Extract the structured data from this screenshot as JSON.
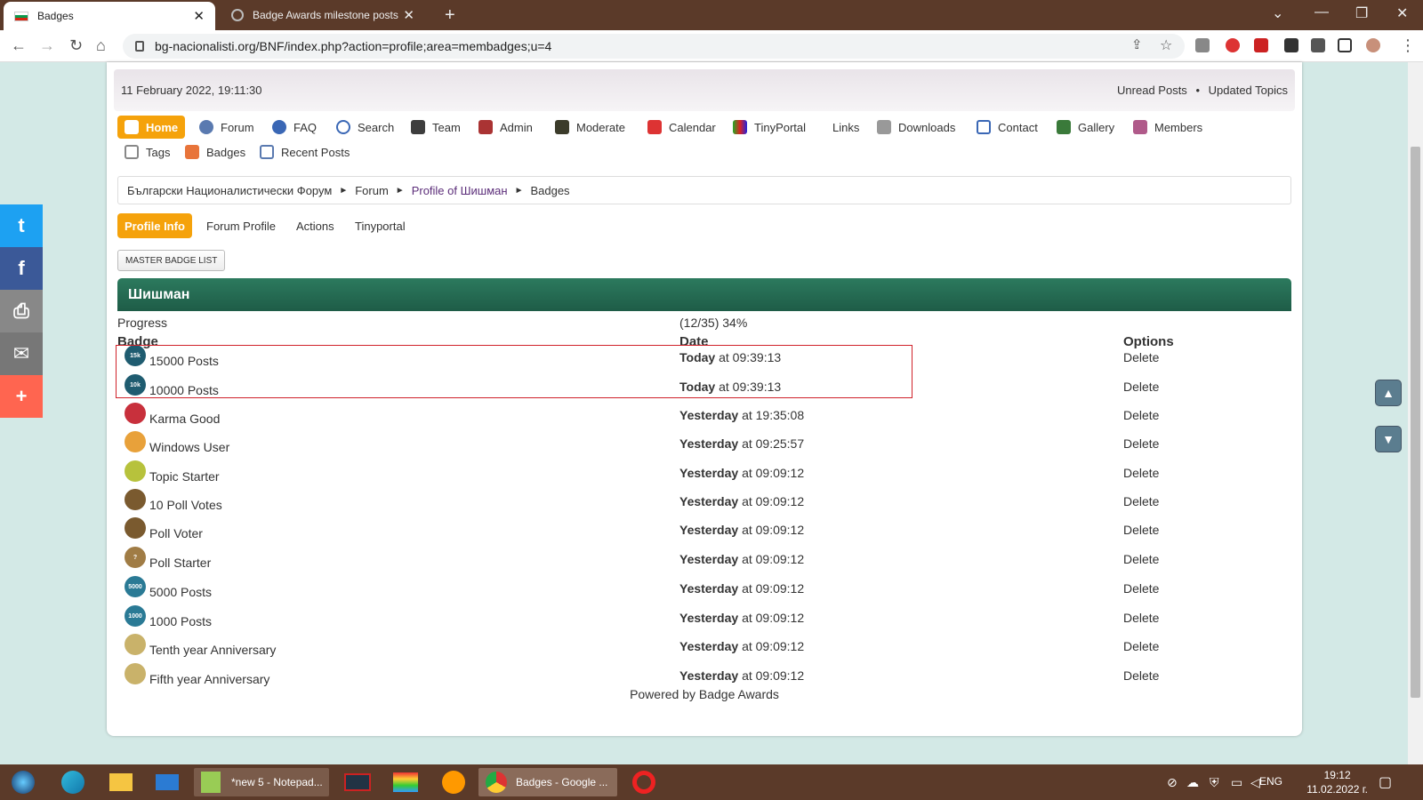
{
  "browser": {
    "tabs": [
      {
        "title": "Badges",
        "active": true
      },
      {
        "title": "Badge Awards milestone posts",
        "active": false
      }
    ],
    "url": "bg-nacionalisti.org/BNF/index.php?action=profile;area=membadges;u=4"
  },
  "header": {
    "date": "11 February 2022, 19:11:30",
    "unread_posts": "Unread Posts",
    "updated_topics": "Updated Topics",
    "dot": "•"
  },
  "menu": {
    "items": [
      {
        "label": "Home",
        "icon": "home-icon"
      },
      {
        "label": "Forum",
        "icon": "forum-icon"
      },
      {
        "label": "FAQ",
        "icon": "help-icon"
      },
      {
        "label": "Search",
        "icon": "search-icon"
      },
      {
        "label": "Team",
        "icon": "team-icon"
      },
      {
        "label": "Admin",
        "icon": "admin-icon"
      },
      {
        "label": "Moderate",
        "icon": "moderate-icon"
      },
      {
        "label": "Calendar",
        "icon": "calendar-icon"
      },
      {
        "label": "TinyPortal",
        "icon": "tinyportal-icon"
      },
      {
        "label": "Links",
        "icon": ""
      },
      {
        "label": "Downloads",
        "icon": "downloads-icon"
      },
      {
        "label": "Contact",
        "icon": "contact-icon"
      },
      {
        "label": "Gallery",
        "icon": "gallery-icon"
      },
      {
        "label": "Members",
        "icon": "members-icon"
      },
      {
        "label": "Tags",
        "icon": "tags-icon"
      },
      {
        "label": "Badges",
        "icon": "badges-icon"
      },
      {
        "label": "Recent Posts",
        "icon": "recent-posts-icon"
      }
    ]
  },
  "breadcrumb": {
    "items": [
      "Български Националистически Форум",
      "Forum",
      "Profile of Шишман",
      "Badges"
    ],
    "separator": "►"
  },
  "profile_tabs": [
    "Profile Info",
    "Forum Profile",
    "Actions",
    "Tinyportal"
  ],
  "master_badge_list": "MASTER BADGE LIST",
  "member_name": "Шишман",
  "progress": {
    "label": "Progress",
    "value": "(12/35) 34%"
  },
  "columns": {
    "badge": "Badge",
    "date": "Date",
    "options": "Options"
  },
  "badges": [
    {
      "name": "15000 Posts",
      "day": "Today",
      "time": "at 09:39:13",
      "action": "Delete",
      "icon_text": "15k",
      "color": "#1f5c70"
    },
    {
      "name": "10000 Posts",
      "day": "Today",
      "time": "at 09:39:13",
      "action": "Delete",
      "icon_text": "10k",
      "color": "#1f5c70"
    },
    {
      "name": "Karma Good",
      "day": "Yesterday",
      "time": "at 19:35:08",
      "action": "Delete",
      "icon_text": "",
      "color": "#c8303c"
    },
    {
      "name": "Windows User",
      "day": "Yesterday",
      "time": "at 09:25:57",
      "action": "Delete",
      "icon_text": "",
      "color": "#e8a13a"
    },
    {
      "name": "Topic Starter",
      "day": "Yesterday",
      "time": "at 09:09:12",
      "action": "Delete",
      "icon_text": "",
      "color": "#b7c23c"
    },
    {
      "name": "10 Poll Votes",
      "day": "Yesterday",
      "time": "at 09:09:12",
      "action": "Delete",
      "icon_text": "",
      "color": "#7a5a2f"
    },
    {
      "name": "Poll Voter",
      "day": "Yesterday",
      "time": "at 09:09:12",
      "action": "Delete",
      "icon_text": "",
      "color": "#7a5a2f"
    },
    {
      "name": "Poll Starter",
      "day": "Yesterday",
      "time": "at 09:09:12",
      "action": "Delete",
      "icon_text": "?",
      "color": "#a07c45"
    },
    {
      "name": "5000 Posts",
      "day": "Yesterday",
      "time": "at 09:09:12",
      "action": "Delete",
      "icon_text": "5000",
      "color": "#2a7a95"
    },
    {
      "name": "1000 Posts",
      "day": "Yesterday",
      "time": "at 09:09:12",
      "action": "Delete",
      "icon_text": "1000",
      "color": "#2a7a95"
    },
    {
      "name": "Tenth year Anniversary",
      "day": "Yesterday",
      "time": "at 09:09:12",
      "action": "Delete",
      "icon_text": "",
      "color": "#c9b26a"
    },
    {
      "name": "Fifth year Anniversary",
      "day": "Yesterday",
      "time": "at 09:09:12",
      "action": "Delete",
      "icon_text": "",
      "color": "#c9b26a"
    }
  ],
  "footer": {
    "powered": "Powered by Badge Awards"
  },
  "taskbar": {
    "items": [
      {
        "label": "*new 5 - Notepad..."
      },
      {
        "label": "Badges - Google ..."
      }
    ],
    "lang": "ENG",
    "time": "19:12",
    "date": "11.02.2022 г."
  },
  "colors": {
    "accent": "#f5a20b",
    "header_green": "#1e5c47",
    "highlight_red": "#d0222a"
  }
}
